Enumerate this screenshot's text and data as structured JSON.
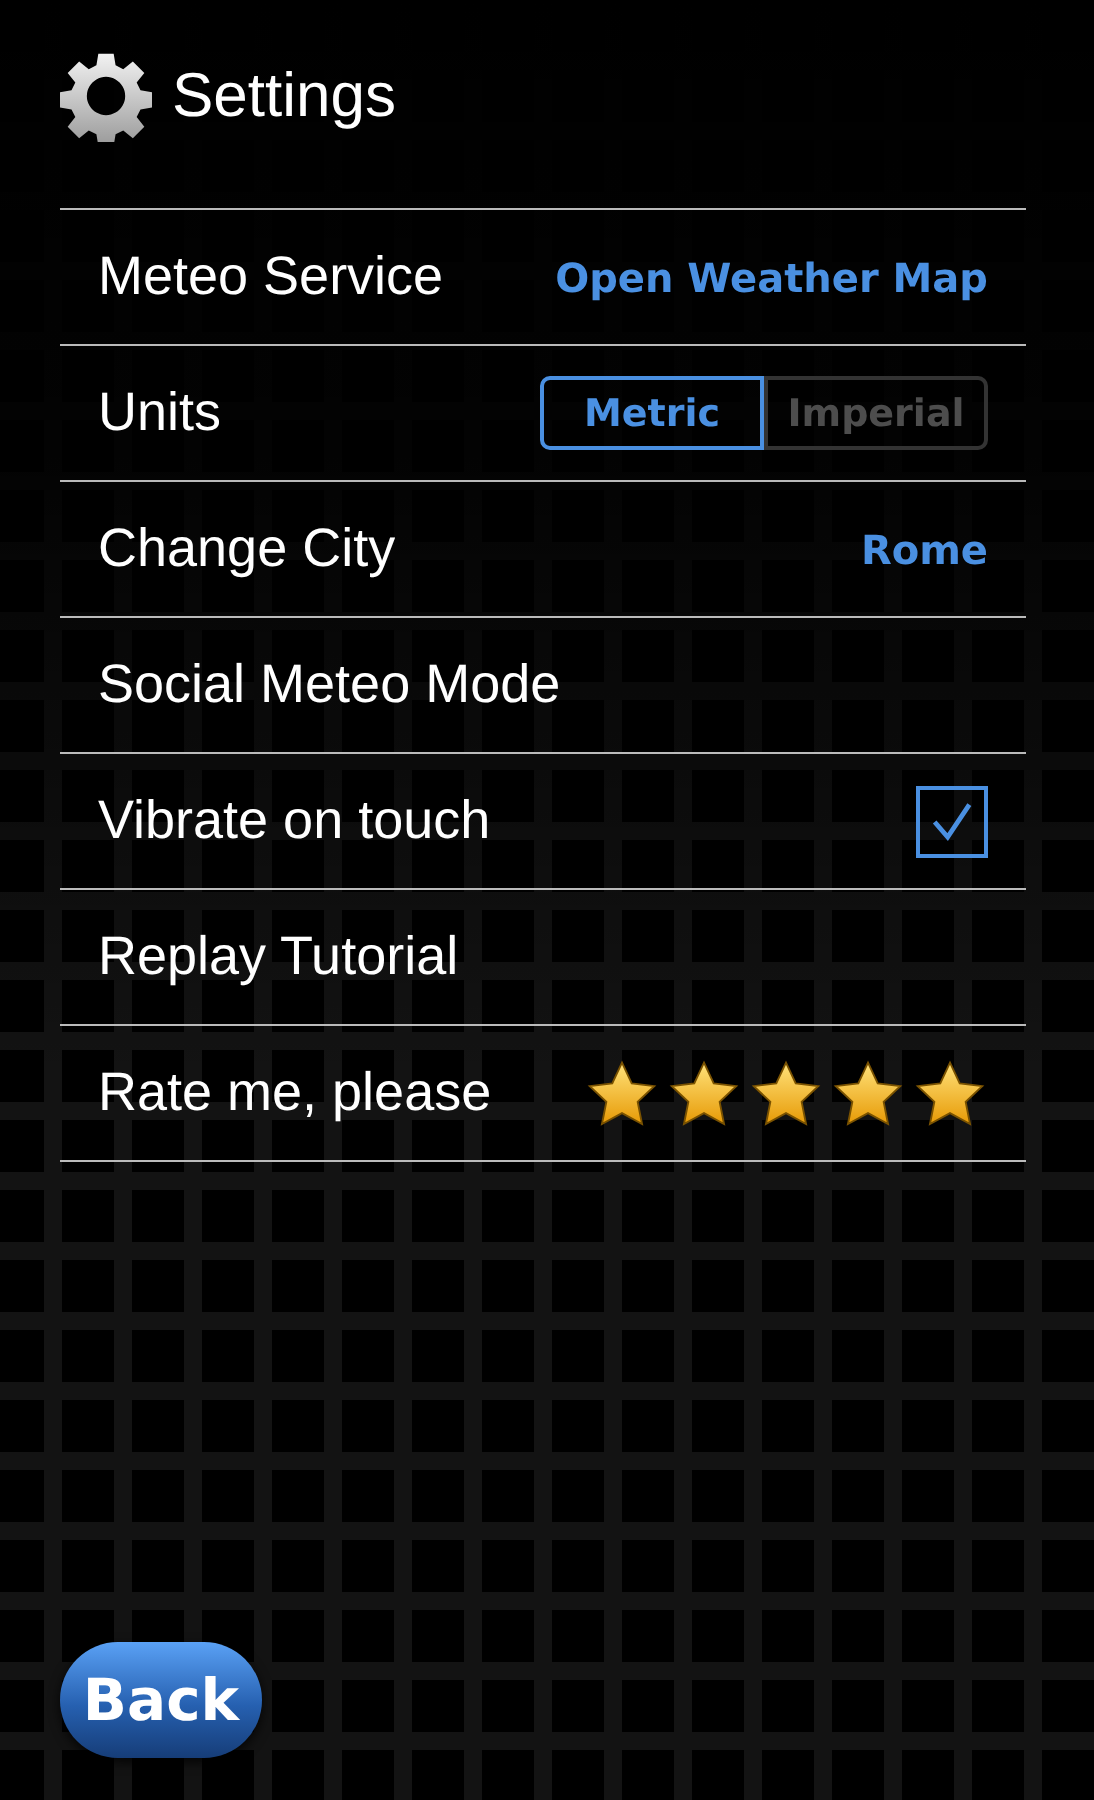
{
  "title": "Settings",
  "settings": [
    {
      "kind": "value",
      "label": "Meteo Service",
      "value": "Open Weather Map"
    },
    {
      "kind": "segmented",
      "label": "Units",
      "options": [
        {
          "label": "Metric",
          "selected": true
        },
        {
          "label": "Imperial",
          "selected": false
        }
      ]
    },
    {
      "kind": "value",
      "label": "Change City",
      "value": "Rome"
    },
    {
      "kind": "plain",
      "label": "Social Meteo Mode"
    },
    {
      "kind": "checkbox",
      "label": "Vibrate on touch",
      "checked": true
    },
    {
      "kind": "plain",
      "label": "Replay Tutorial"
    },
    {
      "kind": "stars",
      "label": "Rate me, please",
      "stars": 5
    }
  ],
  "back_button": "Back"
}
